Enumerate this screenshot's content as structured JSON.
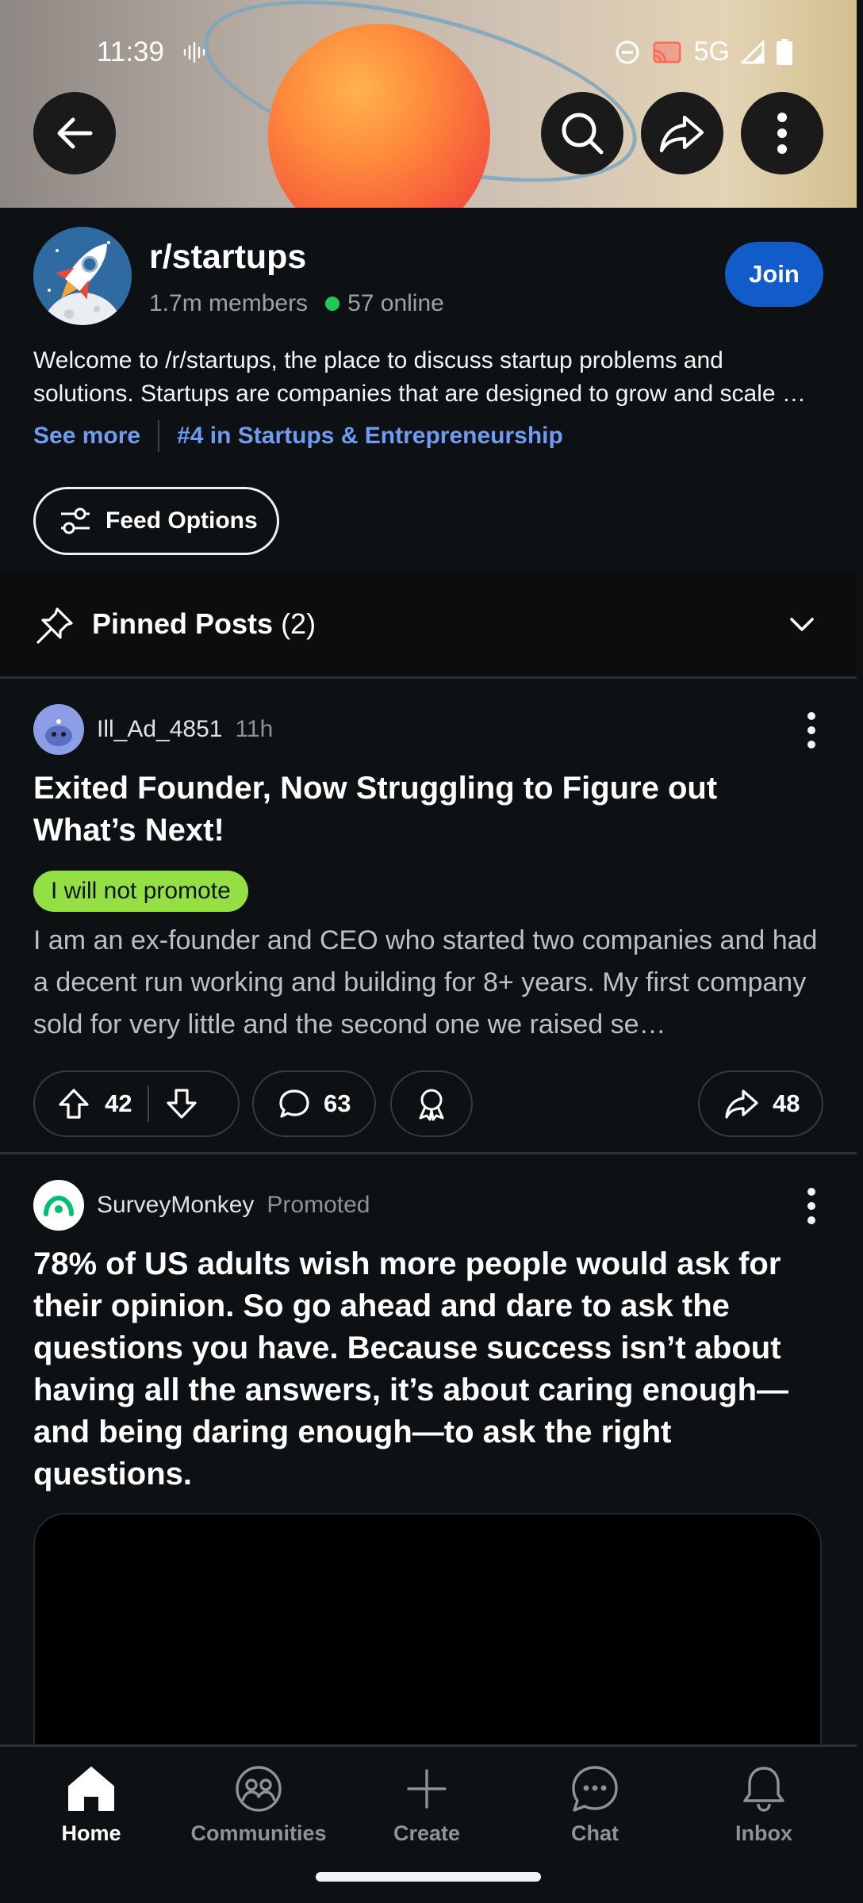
{
  "status_bar": {
    "time": "11:39",
    "network": "5G",
    "icons": [
      "vibrate-icon",
      "do-not-disturb-icon",
      "cast-icon",
      "signal-icon",
      "battery-icon"
    ]
  },
  "top_bar": {
    "buttons": [
      "back-arrow-icon",
      "search-icon",
      "share-icon",
      "more-vertical-icon"
    ]
  },
  "subreddit": {
    "name": "r/startups",
    "members": "1.7m members",
    "online": "57 online",
    "join_label": "Join",
    "description": "Welcome to /r/startups, the place to discuss startup problems and solutions. Startups are companies that are designed to grow and scale …",
    "see_more": "See more",
    "rank": "#4 in Startups & Entrepreneurship",
    "feed_options": "Feed Options"
  },
  "pinned": {
    "label": "Pinned Posts",
    "count": "(2)"
  },
  "posts": [
    {
      "author": "Ill_Ad_4851",
      "age": "11h",
      "title": "Exited Founder, Now Struggling to Figure out What’s Next!",
      "flair": "I will not promote",
      "body": "I am an ex-founder and CEO who started two companies and had a decent run working and building for 8+ years. My first company sold for very little and the second one we raised se…",
      "upvotes": "42",
      "comments": "63",
      "shares": "48"
    },
    {
      "author": "SurveyMonkey",
      "tag": "Promoted",
      "title": "78% of US adults wish more people would ask for their opinion. So go ahead and dare to ask the questions you have. Because success isn’t about having all the answers, it’s about caring enough—and being daring enough—to ask the right questions."
    }
  ],
  "bottom_nav": [
    {
      "label": "Home",
      "icon": "home-icon",
      "active": true
    },
    {
      "label": "Communities",
      "icon": "communities-icon",
      "active": false
    },
    {
      "label": "Create",
      "icon": "plus-icon",
      "active": false
    },
    {
      "label": "Chat",
      "icon": "chat-icon",
      "active": false
    },
    {
      "label": "Inbox",
      "icon": "bell-icon",
      "active": false
    }
  ],
  "colors": {
    "background": "#0e1113",
    "join_blue": "#115bca",
    "link_blue": "#6f9cf2",
    "flair_green": "#94e044",
    "online_green": "#1ec95b"
  }
}
